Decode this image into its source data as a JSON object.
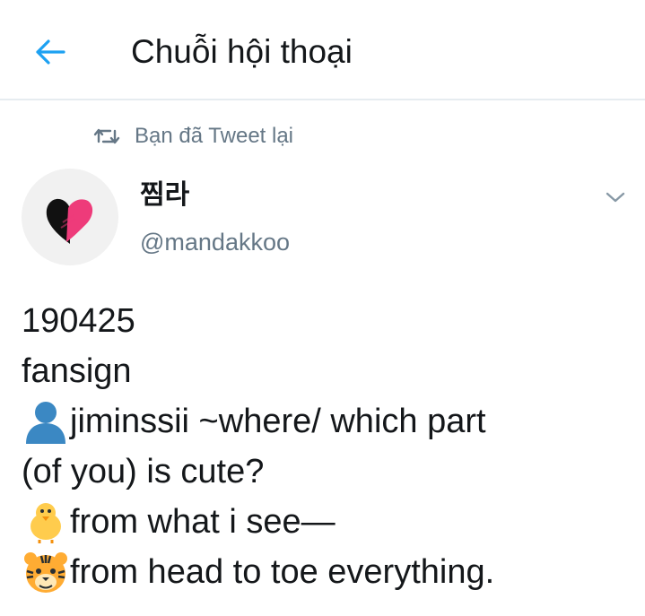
{
  "header": {
    "title": "Chuỗi hội thoại",
    "back_icon": "arrow-left-icon",
    "accent_color": "#1da1f2"
  },
  "retweet": {
    "icon": "retweet-icon",
    "label": "Bạn đã Tweet lại"
  },
  "tweet": {
    "author": {
      "display_name": "찜라",
      "handle": "@mandakkoo",
      "avatar": "black-pink-heart-avatar"
    },
    "menu_icon": "chevron-down-icon",
    "lines": [
      {
        "icon": null,
        "text": "190425"
      },
      {
        "icon": null,
        "text": "fansign"
      },
      {
        "icon": "bust-in-silhouette-emoji",
        "text": "jiminssii ~where/ which part"
      },
      {
        "icon": null,
        "text": "(of you) is cute?"
      },
      {
        "icon": "baby-chick-emoji",
        "text": "from what i see—"
      },
      {
        "icon": "tiger-face-emoji",
        "text": "from head to toe everything."
      }
    ]
  },
  "colors": {
    "text_primary": "#14171a",
    "text_secondary": "#657786",
    "divider": "#e6ecf0"
  }
}
